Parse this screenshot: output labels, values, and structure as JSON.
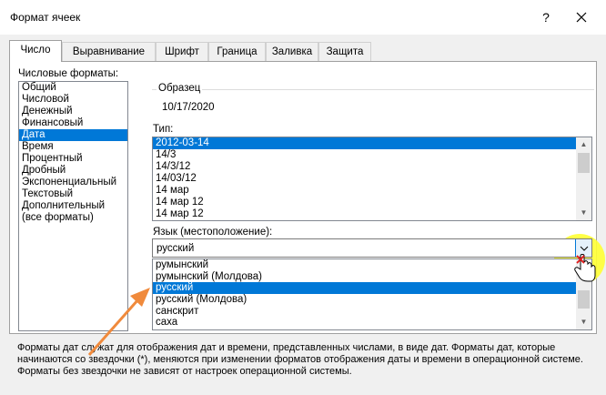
{
  "window": {
    "title": "Формат ячеек",
    "help_label": "?"
  },
  "tabs": [
    "Число",
    "Выравнивание",
    "Шрифт",
    "Граница",
    "Заливка",
    "Защита"
  ],
  "categories": {
    "label": "Числовые форматы:",
    "items": [
      "Общий",
      "Числовой",
      "Денежный",
      "Финансовый",
      "Дата",
      "Время",
      "Процентный",
      "Дробный",
      "Экспоненциальный",
      "Текстовый",
      "Дополнительный",
      "(все форматы)"
    ],
    "selected": "Дата"
  },
  "sample": {
    "label": "Образец",
    "value": "10/17/2020"
  },
  "type": {
    "label": "Тип:",
    "items": [
      "2012-03-14",
      "14/3",
      "14/3/12",
      "14/03/12",
      "14 мар",
      "14 мар 12",
      "14 мар 12"
    ],
    "selected": "2012-03-14"
  },
  "locale": {
    "label": "Язык (местоположение):",
    "value": "русский",
    "options": [
      "румынский",
      "румынский (Молдова)",
      "русский",
      "русский (Молдова)",
      "санскрит",
      "саха"
    ],
    "selected": "русский"
  },
  "description": "Форматы дат служат для отображения дат и времени, представленных числами, в виде дат. Форматы дат, которые начинаются со звездочки (*), меняются при изменении форматов отображения даты и времени в операционной системе. Форматы без звездочки не зависят от настроек операционной системы.",
  "colors": {
    "accent": "#0078d7",
    "highlight": "#ffff33",
    "arrow": "#f08a3c"
  },
  "icons": {
    "close": "close-icon",
    "dropdown": "chevron-down-icon",
    "cursor": "hand-cursor-icon"
  }
}
